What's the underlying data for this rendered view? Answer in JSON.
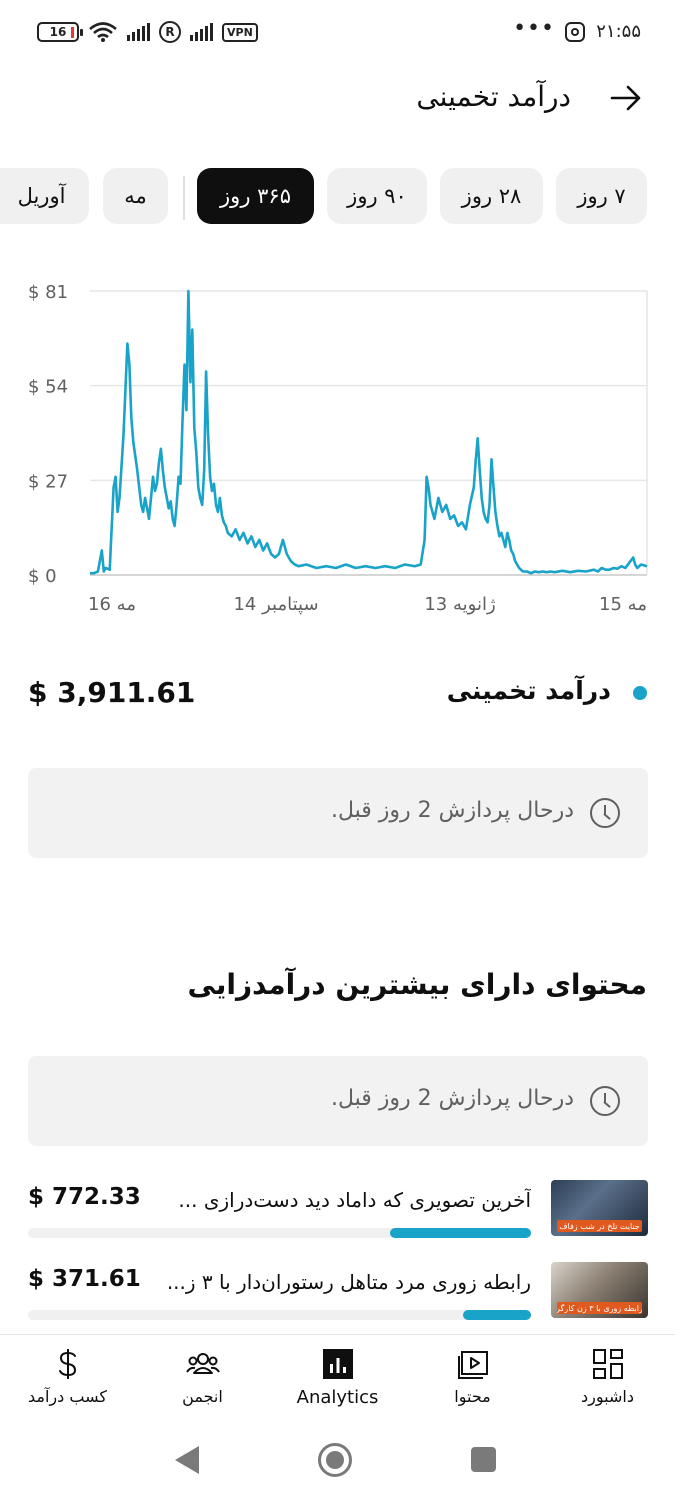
{
  "status_bar": {
    "time": "۲۱:۵۵",
    "dots": "•••",
    "battery": "16",
    "r_badge": "R",
    "vpn": "VPN"
  },
  "header": {
    "title": "درآمد تخمینی",
    "back_icon": "arrow-right-icon"
  },
  "chips": [
    {
      "label": "۷ روز",
      "selected": false
    },
    {
      "label": "۲۸ روز",
      "selected": false
    },
    {
      "label": "۹۰ روز",
      "selected": false
    },
    {
      "label": "۳۶۵ روز",
      "selected": true
    },
    {
      "label": "مه",
      "selected": false
    },
    {
      "label": "آوریل",
      "selected": false
    }
  ],
  "chart_data": {
    "type": "line",
    "series": [
      {
        "color": "#1aa3c8",
        "points": [
          [
            0,
            0.5
          ],
          [
            2,
            0.5
          ],
          [
            4,
            1
          ],
          [
            6,
            7
          ],
          [
            7,
            1
          ],
          [
            8,
            2
          ],
          [
            10,
            1.5
          ],
          [
            12,
            25
          ],
          [
            13,
            28
          ],
          [
            14,
            18
          ],
          [
            15,
            22
          ],
          [
            17,
            40
          ],
          [
            19,
            66
          ],
          [
            20,
            60
          ],
          [
            21,
            45
          ],
          [
            22,
            38
          ],
          [
            24,
            30
          ],
          [
            25,
            25
          ],
          [
            26,
            20
          ],
          [
            27,
            18
          ],
          [
            28,
            22
          ],
          [
            29,
            19
          ],
          [
            30,
            16
          ],
          [
            31,
            22
          ],
          [
            32,
            28
          ],
          [
            33,
            24
          ],
          [
            34,
            26
          ],
          [
            35,
            32
          ],
          [
            36,
            36
          ],
          [
            37,
            30
          ],
          [
            38,
            25
          ],
          [
            39,
            22
          ],
          [
            40,
            19
          ],
          [
            41,
            21
          ],
          [
            42,
            16
          ],
          [
            43,
            14
          ],
          [
            44,
            20
          ],
          [
            45,
            28
          ],
          [
            46,
            26
          ],
          [
            47,
            44
          ],
          [
            48,
            60
          ],
          [
            49,
            47
          ],
          [
            50,
            81
          ],
          [
            51,
            55
          ],
          [
            52,
            70
          ],
          [
            53,
            42
          ],
          [
            54,
            35
          ],
          [
            55,
            25
          ],
          [
            56,
            22
          ],
          [
            57,
            20
          ],
          [
            58,
            30
          ],
          [
            59,
            58
          ],
          [
            60,
            40
          ],
          [
            61,
            28
          ],
          [
            62,
            24
          ],
          [
            63,
            26
          ],
          [
            64,
            20
          ],
          [
            65,
            18
          ],
          [
            66,
            22
          ],
          [
            67,
            17
          ],
          [
            68,
            15
          ],
          [
            69,
            14
          ],
          [
            70,
            12
          ],
          [
            72,
            11
          ],
          [
            74,
            13
          ],
          [
            76,
            10
          ],
          [
            78,
            12
          ],
          [
            80,
            9
          ],
          [
            82,
            11
          ],
          [
            84,
            8
          ],
          [
            86,
            10
          ],
          [
            88,
            7
          ],
          [
            90,
            9
          ],
          [
            92,
            6
          ],
          [
            94,
            5
          ],
          [
            96,
            6
          ],
          [
            98,
            10
          ],
          [
            100,
            6
          ],
          [
            102,
            4
          ],
          [
            104,
            3
          ],
          [
            106,
            2.5
          ],
          [
            110,
            3
          ],
          [
            115,
            2
          ],
          [
            120,
            2.5
          ],
          [
            125,
            2
          ],
          [
            130,
            3
          ],
          [
            135,
            2
          ],
          [
            140,
            2.5
          ],
          [
            145,
            2
          ],
          [
            150,
            2.5
          ],
          [
            155,
            2
          ],
          [
            160,
            3
          ],
          [
            165,
            2.5
          ],
          [
            168,
            3
          ],
          [
            170,
            10
          ],
          [
            171,
            28
          ],
          [
            172,
            25
          ],
          [
            173,
            20
          ],
          [
            175,
            16
          ],
          [
            177,
            22
          ],
          [
            179,
            18
          ],
          [
            181,
            20
          ],
          [
            183,
            16
          ],
          [
            185,
            17
          ],
          [
            187,
            14
          ],
          [
            189,
            15
          ],
          [
            191,
            13
          ],
          [
            193,
            20
          ],
          [
            195,
            25
          ],
          [
            196,
            33
          ],
          [
            197,
            39
          ],
          [
            198,
            30
          ],
          [
            199,
            22
          ],
          [
            200,
            18
          ],
          [
            201,
            16
          ],
          [
            202,
            15
          ],
          [
            203,
            20
          ],
          [
            204,
            33
          ],
          [
            205,
            25
          ],
          [
            206,
            18
          ],
          [
            207,
            14
          ],
          [
            208,
            11
          ],
          [
            209,
            12
          ],
          [
            210,
            10
          ],
          [
            211,
            8
          ],
          [
            212,
            12
          ],
          [
            213,
            10
          ],
          [
            214,
            7
          ],
          [
            215,
            6
          ],
          [
            216,
            4
          ],
          [
            217,
            3
          ],
          [
            218,
            2
          ],
          [
            220,
            1
          ],
          [
            222,
            1
          ],
          [
            224,
            0.5
          ],
          [
            226,
            1
          ],
          [
            228,
            0.8
          ],
          [
            230,
            1
          ],
          [
            232,
            0.8
          ],
          [
            234,
            1
          ],
          [
            236,
            0.8
          ],
          [
            240,
            1.2
          ],
          [
            244,
            0.8
          ],
          [
            248,
            1.2
          ],
          [
            252,
            1
          ],
          [
            256,
            1.5
          ],
          [
            258,
            1
          ],
          [
            260,
            2
          ],
          [
            262,
            1.5
          ],
          [
            264,
            1.5
          ],
          [
            266,
            2
          ],
          [
            268,
            1.8
          ],
          [
            270,
            2.5
          ],
          [
            272,
            2
          ],
          [
            274,
            3.5
          ],
          [
            276,
            5
          ],
          [
            277,
            3
          ],
          [
            278,
            2
          ],
          [
            280,
            3
          ],
          [
            283,
            2.5
          ]
        ]
      }
    ],
    "x_range": [
      0,
      283
    ],
    "ylim": [
      0,
      81
    ],
    "y_ticks": [
      "$ 0",
      "$ 27",
      "$ 54",
      "$ 81"
    ],
    "y_tick_values": [
      0,
      27,
      54,
      81
    ],
    "x_ticks": [
      "16 مه",
      "14 سپتامبر",
      "13 ژانویه",
      "15 مه"
    ],
    "grid": true
  },
  "total": {
    "label": "درآمد تخمینی",
    "value": "$ 3,911.61"
  },
  "notice_text": "درحال پردازش 2 روز قبل.",
  "section_title": "محتوای دارای بیشترین درآمدزایی",
  "items": [
    {
      "title": "آخرین تصویری که داماد دید دست‌درازی ...",
      "amount": "$ 772.33",
      "progress": 0.28,
      "thumb_caption": "جنایت تلخ در شب زفاف"
    },
    {
      "title": "رابطه زوری مرد متاهل رستوران‌دار با ۳ ز...",
      "amount": "$ 371.61",
      "progress": 0.135,
      "thumb_caption": "رابطه زوری با ۳ زن کارگر"
    }
  ],
  "bottom_nav": [
    {
      "label": "داشبورد",
      "icon": "dashboard-icon"
    },
    {
      "label": "محتوا",
      "icon": "content-icon"
    },
    {
      "label": "Analytics",
      "icon": "analytics-icon",
      "active": true
    },
    {
      "label": "انجمن",
      "icon": "community-icon"
    },
    {
      "label": "کسب درآمد",
      "icon": "dollar-icon"
    }
  ]
}
